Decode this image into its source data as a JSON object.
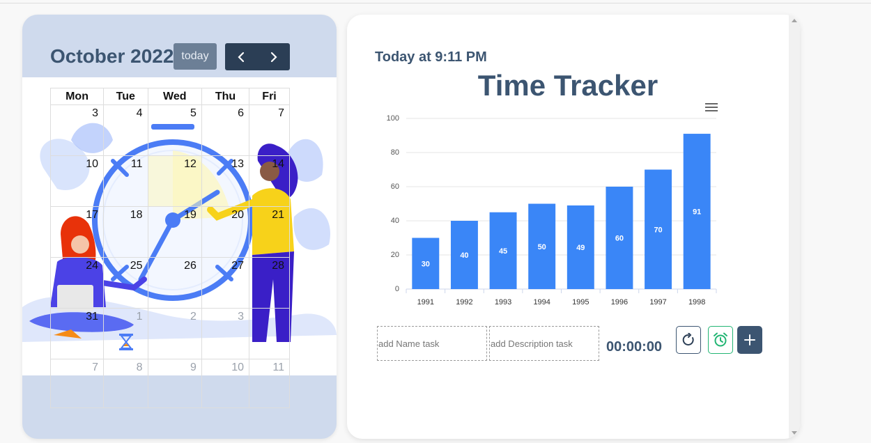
{
  "calendar": {
    "title": "October 2022",
    "today_label": "today",
    "weekdays": [
      "Mon",
      "Tue",
      "Wed",
      "Thu",
      "Fri"
    ],
    "weeks": [
      [
        "3",
        "4",
        "5",
        "6",
        "7"
      ],
      [
        "10",
        "11",
        "12",
        "13",
        "14"
      ],
      [
        "17",
        "18",
        "19",
        "20",
        "21"
      ],
      [
        "24",
        "25",
        "26",
        "27",
        "28"
      ],
      [
        "31",
        "1",
        "2",
        "3",
        ""
      ],
      [
        "7",
        "8",
        "9",
        "10",
        "11"
      ]
    ],
    "today_date": "12"
  },
  "tracker": {
    "today_text": "Today at 9:11 PM",
    "title": "Time Tracker",
    "name_placeholder": "add Name task",
    "desc_placeholder": "add Description task",
    "timer": "00:00:00"
  },
  "icons": {
    "prev": "chevron-left-icon",
    "next": "chevron-right-icon",
    "menu": "hamburger-menu-icon",
    "reset": "rotate-icon",
    "alarm": "alarm-clock-icon",
    "add": "plus-icon",
    "hourglass": "hourglass-icon"
  },
  "colors": {
    "accent": "#3c5571",
    "bar": "#3a86f7",
    "card_bg": "#cfdaed",
    "alarm": "#22b573"
  },
  "chart_data": {
    "type": "bar",
    "categories": [
      "1991",
      "1992",
      "1993",
      "1994",
      "1995",
      "1996",
      "1997",
      "1998"
    ],
    "values": [
      30,
      40,
      45,
      50,
      49,
      60,
      70,
      91
    ],
    "ylim": [
      0,
      100
    ],
    "yticks": [
      0,
      20,
      40,
      60,
      80,
      100
    ],
    "grid": true,
    "data_labels": true
  }
}
